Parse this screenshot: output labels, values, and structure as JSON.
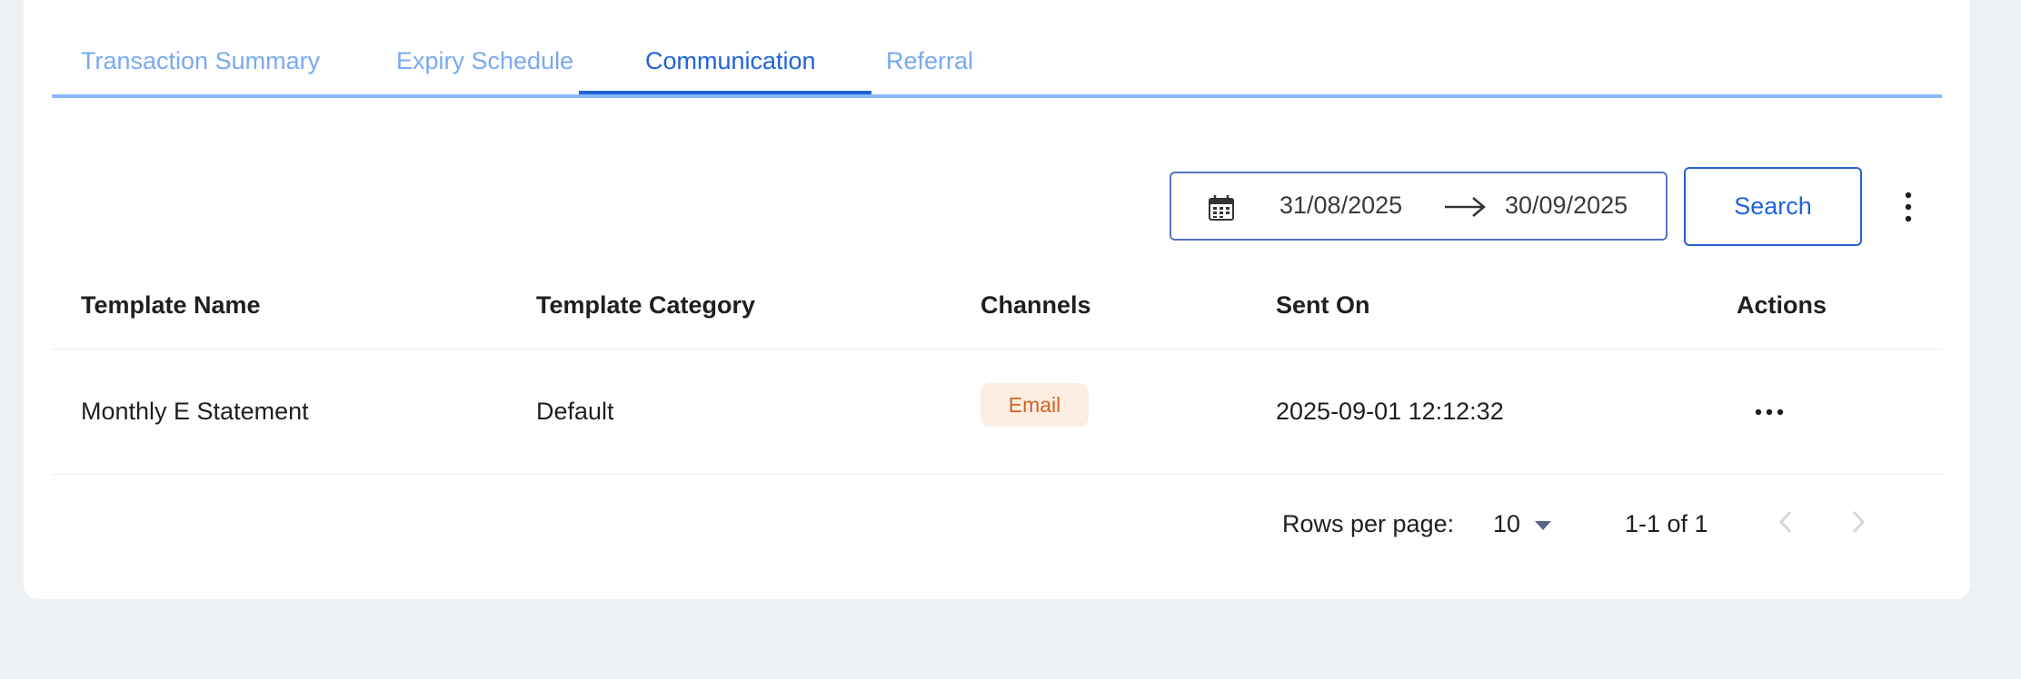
{
  "tabs": [
    {
      "label": "Transaction Summary",
      "active": false
    },
    {
      "label": "Expiry Schedule",
      "active": false
    },
    {
      "label": "Communication",
      "active": true
    },
    {
      "label": "Referral",
      "active": false
    }
  ],
  "filter": {
    "calendar_icon": "calendar-icon",
    "start_date": "31/08/2025",
    "arrow_icon": "arrow-right-icon",
    "end_date": "30/09/2025",
    "search_label": "Search",
    "more_icon": "vertical-ellipsis-icon"
  },
  "table": {
    "columns": [
      "Template Name",
      "Template Category",
      "Channels",
      "Sent On",
      "Actions"
    ],
    "rows": [
      {
        "template_name": "Monthly E Statement",
        "template_category": "Default",
        "channel": "Email",
        "sent_on": "2025-09-01 12:12:32",
        "actions_icon": "horizontal-ellipsis-icon"
      }
    ]
  },
  "pagination": {
    "rows_per_page_label": "Rows per page:",
    "rows_per_page_value": "10",
    "range_text": "1-1 of 1",
    "prev_icon": "chevron-left-icon",
    "next_icon": "chevron-right-icon"
  },
  "colors": {
    "accent": "#1f63d6",
    "tab_inactive": "#7aa9f0",
    "badge_bg": "#fdeee2",
    "badge_text": "#d4622a",
    "page_bg": "#eef1f4"
  }
}
